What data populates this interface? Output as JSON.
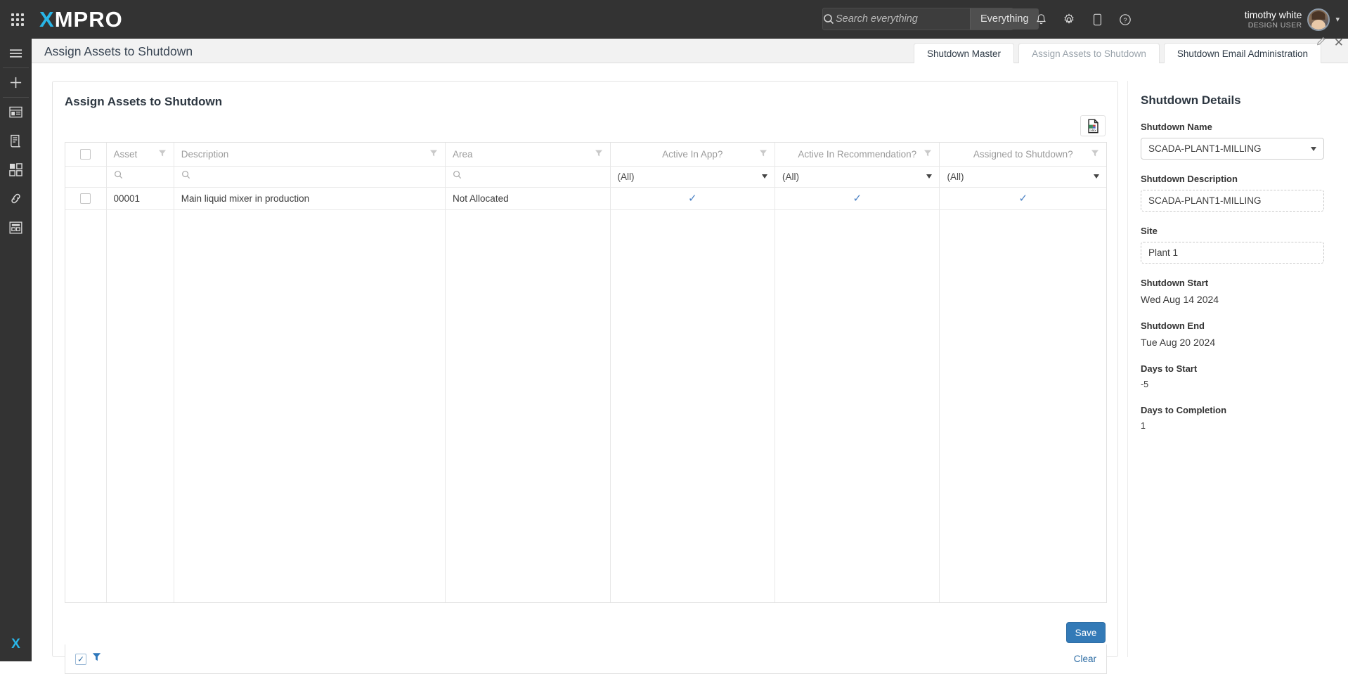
{
  "topbar": {
    "brand_x": "X",
    "brand_rest": "MPRO",
    "apps_icon": "apps-grid-icon",
    "search": {
      "placeholder": "Search everything",
      "value": "",
      "scope_label": "Everything"
    },
    "icons": [
      {
        "name": "notifications-icon",
        "glyph": "bell"
      },
      {
        "name": "settings-gear-icon",
        "glyph": "gear"
      },
      {
        "name": "mobile-device-icon",
        "glyph": "phone"
      },
      {
        "name": "help-icon",
        "glyph": "question"
      }
    ],
    "user": {
      "name": "timothy white",
      "role": "DESIGN USER",
      "caret": "▾"
    }
  },
  "rail": {
    "items": [
      {
        "name": "menu-hamburger-icon"
      },
      {
        "name": "add-new-icon"
      },
      {
        "name": "dashboard-icon"
      },
      {
        "name": "report-icon"
      },
      {
        "name": "apps-tiles-icon"
      },
      {
        "name": "link-icon"
      },
      {
        "name": "form-icon"
      }
    ],
    "logo_x": "X"
  },
  "tabbar": {
    "page_title": "Assign Assets to Shutdown",
    "tabs": [
      {
        "label": "Shutdown Master",
        "active": true
      },
      {
        "label": "Assign Assets to Shutdown",
        "active": false
      },
      {
        "label": "Shutdown Email Administration",
        "active": true
      }
    ],
    "edit_icon": "pencil-edit-icon",
    "close_icon": "close-icon",
    "close_glyph": "✕"
  },
  "card": {
    "title": "Assign Assets to Shutdown",
    "export_label": "xlsx",
    "export_icon": "export-xlsx-icon"
  },
  "grid": {
    "columns": [
      {
        "key": "check",
        "label": "",
        "align": "center",
        "filterable": false
      },
      {
        "key": "asset",
        "label": "Asset",
        "align": "left",
        "filterable": true
      },
      {
        "key": "desc",
        "label": "Description",
        "align": "left",
        "filterable": true
      },
      {
        "key": "area",
        "label": "Area",
        "align": "left",
        "filterable": true
      },
      {
        "key": "app",
        "label": "Active In App?",
        "align": "center",
        "filterable": true
      },
      {
        "key": "rec",
        "label": "Active In Recommendation?",
        "align": "center",
        "filterable": true
      },
      {
        "key": "assign",
        "label": "Assigned to Shutdown?",
        "align": "center",
        "filterable": true
      }
    ],
    "filter_row": {
      "asset": {
        "type": "search",
        "value": ""
      },
      "desc": {
        "type": "search",
        "value": ""
      },
      "area": {
        "type": "search",
        "value": ""
      },
      "app": {
        "type": "select",
        "value": "(All)"
      },
      "rec": {
        "type": "select",
        "value": "(All)"
      },
      "assign": {
        "type": "select",
        "value": "(All)"
      }
    },
    "rows": [
      {
        "selected": false,
        "asset": "00001",
        "desc": "Main liquid mixer in production",
        "area": "Not Allocated",
        "app": true,
        "rec": true,
        "assign": true
      }
    ],
    "check_glyph": "✓",
    "footer": {
      "enabled_checkbox": true,
      "check_glyph": "✓",
      "filter_icon": "funnel-filter-icon",
      "clear_label": "Clear"
    }
  },
  "actions": {
    "save_label": "Save"
  },
  "details": {
    "title": "Shutdown Details",
    "shutdown_name_label": "Shutdown Name",
    "shutdown_name_value": "SCADA-PLANT1-MILLING",
    "shutdown_description_label": "Shutdown Description",
    "shutdown_description_value": "SCADA-PLANT1-MILLING",
    "site_label": "Site",
    "site_value": "Plant 1",
    "shutdown_start_label": "Shutdown Start",
    "shutdown_start_value": "Wed Aug 14 2024",
    "shutdown_end_label": "Shutdown End",
    "shutdown_end_value": "Tue Aug 20 2024",
    "days_to_start_label": "Days to Start",
    "days_to_start_value": "-5",
    "days_to_completion_label": "Days to Completion",
    "days_to_completion_value": "1"
  },
  "colors": {
    "topbar_bg": "#333333",
    "brand_accent": "#29b6e8",
    "primary_button": "#337ab7",
    "link": "#2e6da4",
    "tick": "#4a81c4"
  }
}
